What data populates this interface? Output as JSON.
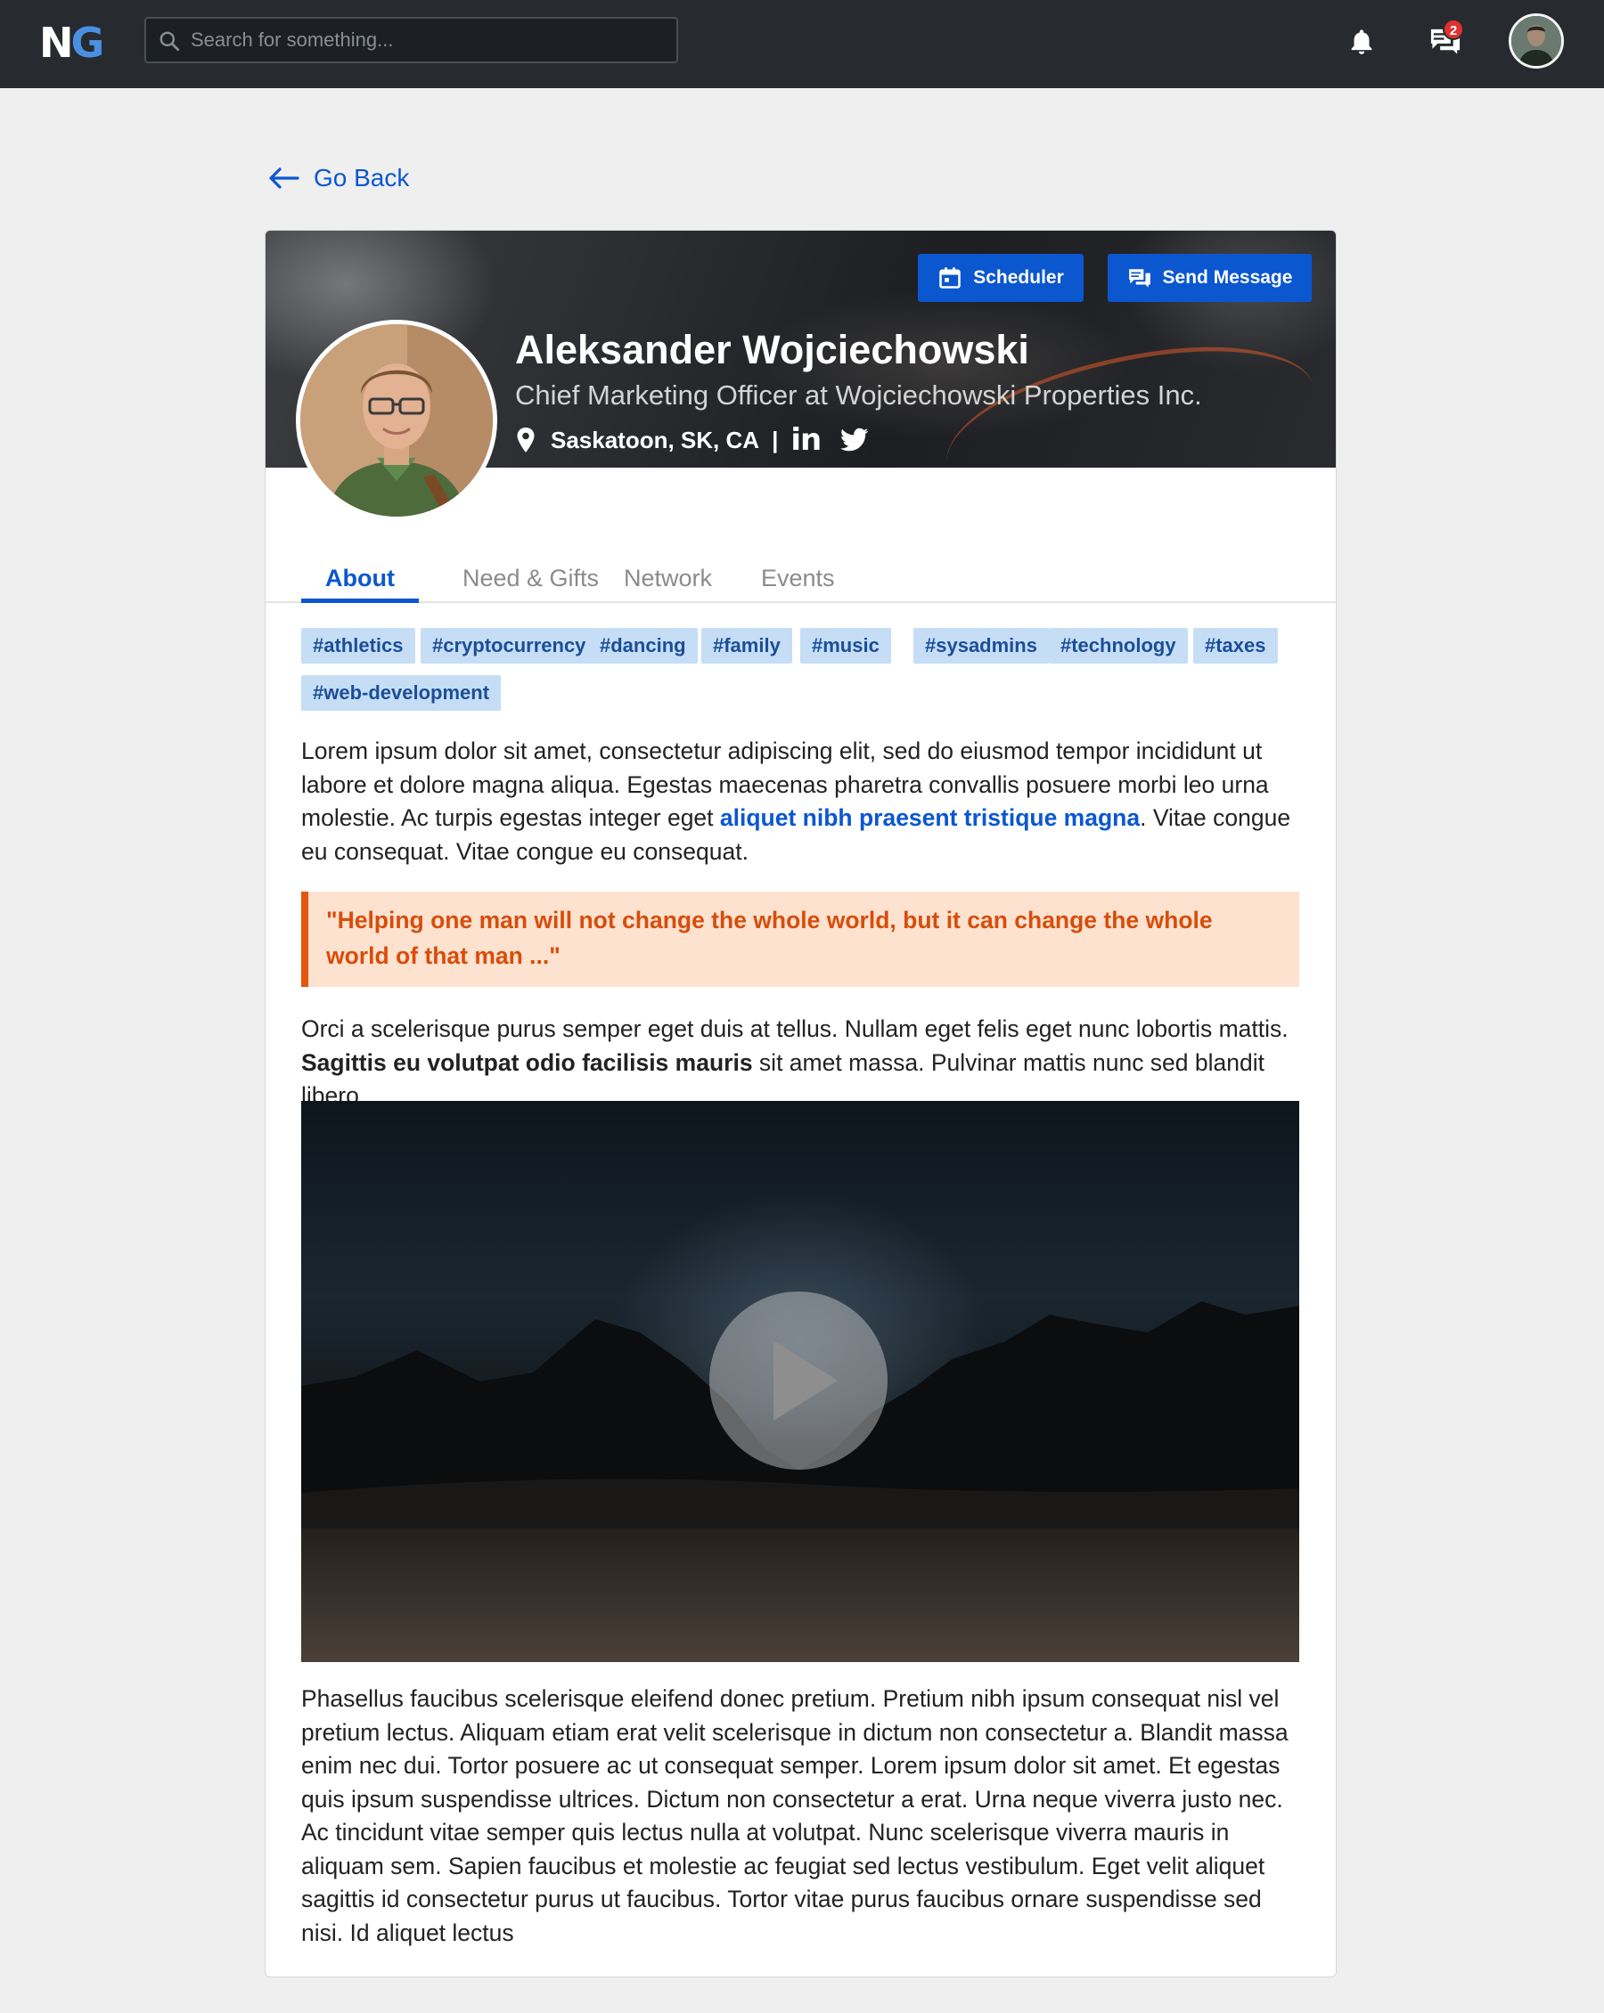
{
  "topbar": {
    "logo_n": "N",
    "logo_g": "G",
    "search_placeholder": "Search for something...",
    "chat_badge": "2",
    "icons": [
      "search-icon",
      "bell-icon",
      "chat-icon",
      "avatar"
    ]
  },
  "nav": {
    "go_back": "Go Back"
  },
  "profile": {
    "name": "Aleksander Wojciechowski",
    "title": "Chief Marketing Officer at Wojciechowski Properties Inc.",
    "location": "Saskatoon, SK, CA",
    "separator": "|",
    "linkedin": "in",
    "buttons": {
      "scheduler": "Scheduler",
      "send_message": "Send Message"
    }
  },
  "tabs": [
    "About",
    "Need & Gifts",
    "Network",
    "Events"
  ],
  "active_tab": "About",
  "tags": [
    "#athletics",
    "#cryptocurrency",
    "#dancing",
    "#family",
    "#music",
    "#sysadmins",
    "#technology",
    "#taxes",
    "#web-development"
  ],
  "about": {
    "p1_before": "Lorem ipsum dolor sit amet, consectetur adipiscing elit, sed do eiusmod tempor incididunt ut labore et dolore magna aliqua. Egestas maecenas pharetra convallis posuere morbi leo urna molestie. Ac turpis egestas integer eget ",
    "p1_link": "aliquet nibh praesent tristique magna",
    "p1_after": ". Vitae congue eu consequat. Vitae congue eu consequat.",
    "quote": "\"Helping one man will not change the whole world, but it can change the whole world of that man ...\"",
    "p2_before": "Orci a scelerisque purus semper eget duis at tellus. Nullam eget felis eget nunc lobortis mattis. ",
    "p2_bold": "Sagittis eu volutpat odio facilisis mauris",
    "p2_after": " sit amet massa. Pulvinar mattis nunc sed blandit libero.",
    "p3": "Phasellus faucibus scelerisque eleifend donec pretium. Pretium nibh ipsum consequat nisl vel pretium lectus. Aliquam etiam erat velit scelerisque in dictum non consectetur a. Blandit massa enim nec dui. Tortor posuere ac ut consequat semper. Lorem ipsum dolor sit amet. Et egestas quis ipsum suspendisse ultrices. Dictum non consectetur a erat. Urna neque viverra justo nec. Ac tincidunt vitae semper quis lectus nulla at volutpat. Nunc scelerisque viverra mauris in aliquam sem. Sapien faucibus et molestie ac feugiat sed lectus vestibulum. Eget velit aliquet sagittis id consectetur purus ut faucibus. Tortor vitae purus faucibus ornare suspendisse sed nisi. Id aliquet lectus"
  },
  "colors": {
    "accent": "#0b57d0",
    "topbar": "#272b30",
    "tag_bg": "#c6ddf6",
    "quote_bg": "#fde2d0",
    "quote_text": "#d84d0a",
    "badge": "#e03131"
  }
}
